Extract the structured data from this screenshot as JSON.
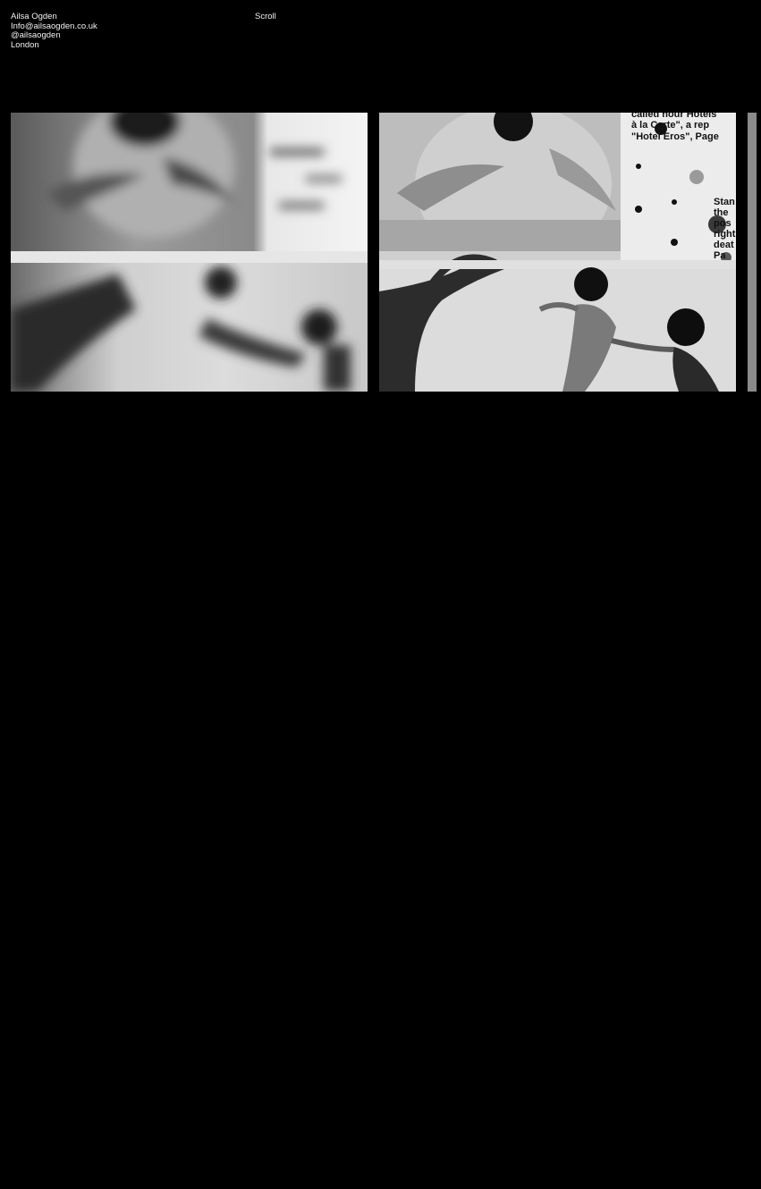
{
  "header": {
    "name": "Ailsa Ogden",
    "email": "Info@ailsaogden.co.uk",
    "handle": "@ailsaogden",
    "location": "London",
    "scroll_label": "Scroll"
  },
  "gallery": {
    "images": [
      {
        "description": "blurred black and white collage of embracing figures",
        "focus": "blurred"
      },
      {
        "description": "black and white collage of embracing figures and dancing figures with printed text",
        "focus": "sharp"
      },
      {
        "description": "partially visible next image",
        "focus": "partial"
      }
    ],
    "image_text": [
      "called hour Hotels",
      "à la Carte\", a rep",
      "\"Hotel Eros\", Page",
      "Stan",
      "the",
      "pos",
      "right",
      "deat",
      "Pa"
    ]
  },
  "colors": {
    "background": "#000000",
    "text": "#f2f2f2"
  }
}
